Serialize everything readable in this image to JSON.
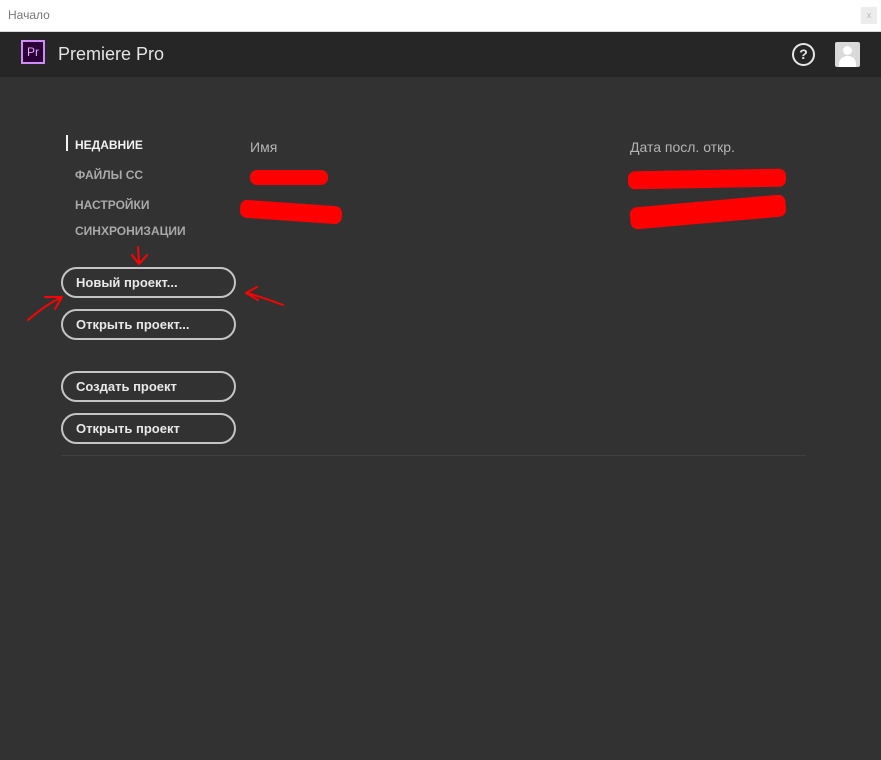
{
  "window": {
    "title": "Начало",
    "close_glyph": "x"
  },
  "header": {
    "logo_text": "Pr",
    "app_name": "Premiere Pro",
    "help_glyph": "?"
  },
  "nav": {
    "items": [
      {
        "label": "НЕДАВНИЕ",
        "active": true
      },
      {
        "label": "ФАЙЛЫ СС",
        "active": false
      },
      {
        "label": "НАСТРОЙКИ",
        "active": false
      },
      {
        "label": "СИНХРОНИЗАЦИИ",
        "active": false
      }
    ]
  },
  "actions": {
    "new_project": "Новый проект...",
    "open_project_dialog": "Открыть проект...",
    "create_project": "Создать проект",
    "open_project": "Открыть проект"
  },
  "recent_list": {
    "columns": {
      "name": "Имя",
      "date": "Дата посл. откр."
    }
  },
  "colors": {
    "background": "#323232",
    "header": "#262626",
    "accent_logo": "#d08cf5",
    "annotation_red": "#ff0000"
  },
  "icons": [
    "premiere-logo-icon",
    "help-icon",
    "user-avatar-icon",
    "close-icon"
  ]
}
